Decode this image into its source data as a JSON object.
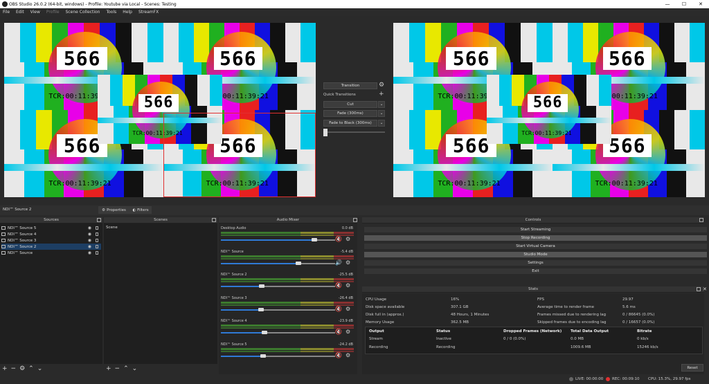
{
  "window": {
    "title": "OBS Studio 26.0.2 (64-bit, windows) - Profile: Youtube via Local - Scenes: Testing",
    "minimize": "—",
    "maximize": "☐",
    "close": "✕"
  },
  "menu": [
    "File",
    "Edit",
    "View",
    "Profile",
    "Scene Collection",
    "Tools",
    "Help",
    "StreamFX"
  ],
  "preview": {
    "big_number": "566",
    "timecode": "TCR:00:11:39:21",
    "timecode_small": "TCR:00:11:39:21"
  },
  "transition": {
    "button": "Transition",
    "quick_label": "Quick Transitions",
    "items": [
      "Cut",
      "Fade (300ms)",
      "Fade to Black (300ms)"
    ]
  },
  "source_bar": {
    "selected": "NDI™ Source 2",
    "properties": "Properties",
    "filters": "Filters"
  },
  "sources": {
    "title": "Sources",
    "items": [
      "NDI™ Source 5",
      "NDI™ Source 4",
      "NDI™ Source 3",
      "NDI™ Source 2",
      "NDI™ Source"
    ]
  },
  "scenes": {
    "title": "Scenes",
    "items": [
      "Scene"
    ]
  },
  "mixer": {
    "title": "Audio Mixer",
    "channels": [
      {
        "name": "Desktop Audio",
        "db": "0.0 dB",
        "level": 0.82,
        "muted": true
      },
      {
        "name": "NDI™ Source",
        "db": "-5.4 dB",
        "level": 0.68,
        "muted": false
      },
      {
        "name": "NDI™ Source 2",
        "db": "-25.5 dB",
        "level": 0.36,
        "muted": true
      },
      {
        "name": "NDI™ Source 3",
        "db": "-26.4 dB",
        "level": 0.35,
        "muted": true
      },
      {
        "name": "NDI™ Source 4",
        "db": "-23.9 dB",
        "level": 0.38,
        "muted": true
      },
      {
        "name": "NDI™ Source 5",
        "db": "-24.2 dB",
        "level": 0.37,
        "muted": true
      }
    ]
  },
  "controls": {
    "title": "Controls",
    "buttons": [
      "Start Streaming",
      "Stop Recording",
      "Start Virtual Camera",
      "Studio Mode",
      "Settings",
      "Exit"
    ]
  },
  "stats": {
    "title": "Stats",
    "left": [
      [
        "CPU Usage",
        "16%"
      ],
      [
        "Disk space available",
        "307.1 GB"
      ],
      [
        "Disk full in (approx.)",
        "48 Hours, 1 Minutes"
      ],
      [
        "Memory Usage",
        "362.5 MB"
      ]
    ],
    "right": [
      [
        "FPS",
        "29.97"
      ],
      [
        "Average time to render frame",
        "5.6 ms"
      ],
      [
        "Frames missed due to rendering lag",
        "0 / 86645 (0.0%)"
      ],
      [
        "Skipped frames due to encoding lag",
        "0 / 16657 (0.0%)"
      ]
    ],
    "table_headers": [
      "Output",
      "Status",
      "Dropped Frames (Network)",
      "Total Data Output",
      "Bitrate"
    ],
    "rows": [
      [
        "Stream",
        "Inactive",
        "0 / 0 (0.0%)",
        "0.0 MB",
        "0 kb/s"
      ],
      [
        "Recording",
        "Recording",
        "",
        "1009.6 MB",
        "15246 kb/s"
      ]
    ],
    "reset": "Reset"
  },
  "statusbar": {
    "live": "LIVE: 00:00:00",
    "rec": "REC: 00:09:10",
    "cpu": "CPU: 15.3%, 29.97 fps"
  },
  "colors": {
    "selection": "#1d3e63",
    "rec_red": "#e03030",
    "slider_blue": "#2f7ad6"
  }
}
